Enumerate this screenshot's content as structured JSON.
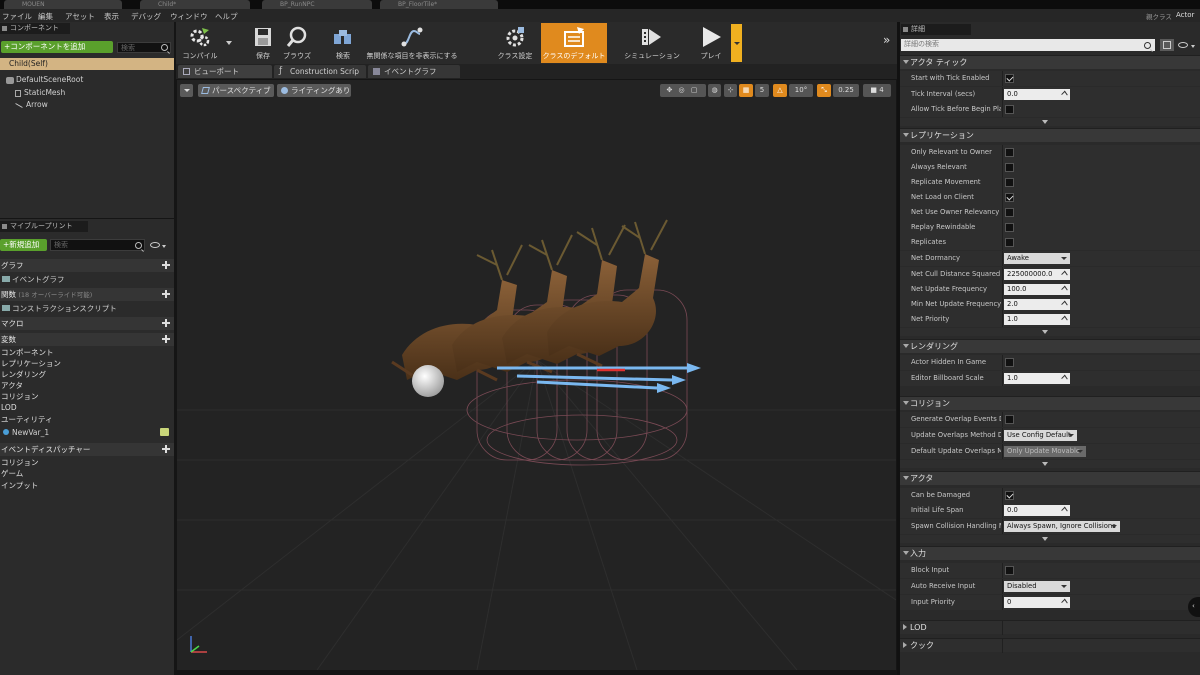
{
  "file_tabs": [
    "MOUEN",
    "Child*",
    "BP_RunNPC",
    "BP_FloorTile*"
  ],
  "menu": {
    "items": [
      "ファイル",
      "編集",
      "アセット",
      "表示",
      "デバッグ",
      "ウィンドウ",
      "ヘルプ"
    ],
    "parent_class": "親クラス",
    "parent_value": "Actor"
  },
  "components": {
    "header": "コンポーネント",
    "add_button": "+コンポーネントを追加",
    "search_placeholder": "検索",
    "self": "Child(Self)",
    "tree": [
      "DefaultSceneRoot",
      "StaticMesh",
      "Arrow"
    ]
  },
  "my_blueprint": {
    "header": "マイブループリント",
    "add_new": "+新規追加",
    "search_placeholder": "検索",
    "graph": "グラフ",
    "event_graph": "イベントグラフ",
    "functions": "関数",
    "functions_note": "(18 オーバーライド可能)",
    "construction_script": "コンストラクションスクリプト",
    "macros": "マクロ",
    "variables": "変数",
    "variable_categories": [
      "コンポーネント",
      "レプリケーション",
      "レンダリング",
      "アクタ",
      "コリジョン",
      "LOD",
      "ユーティリティ"
    ],
    "new_var": "NewVar_1",
    "dispatchers": "イベントディスパッチャー",
    "dispatcher_categories": [
      "コリジョン",
      "ゲーム",
      "インプット"
    ]
  },
  "toolbar": {
    "compile": "コンパイル",
    "save": "保存",
    "browse": "ブラウズ",
    "find": "検索",
    "hide_unrelated": "無関係な項目を非表示にする",
    "class_settings": "クラス設定",
    "class_defaults": "クラスのデフォルト",
    "simulation": "シミュレーション",
    "play": "プレイ"
  },
  "editor_tabs": [
    "ビューポート",
    "Construction Scrip",
    "イベントグラフ"
  ],
  "viewport": {
    "perspective": "パースペクティブ",
    "lighting": "ライティングあり",
    "grid_value": "5",
    "angle_value": "10°",
    "scale_value": "0.25",
    "camera_value": "4"
  },
  "details": {
    "header": "詳細",
    "search_placeholder": "詳細の検索",
    "sections": [
      {
        "title": "アクタ ティック",
        "rows": [
          {
            "label": "Start with Tick Enabled",
            "type": "check",
            "value": true
          },
          {
            "label": "Tick Interval (secs)",
            "type": "num",
            "value": "0.0"
          },
          {
            "label": "Allow Tick Before Begin Play",
            "type": "check",
            "value": false
          }
        ]
      },
      {
        "title": "レプリケーション",
        "rows": [
          {
            "label": "Only Relevant to Owner",
            "type": "check",
            "value": false
          },
          {
            "label": "Always Relevant",
            "type": "check",
            "value": false
          },
          {
            "label": "Replicate Movement",
            "type": "check",
            "value": false
          },
          {
            "label": "Net Load on Client",
            "type": "check",
            "value": true
          },
          {
            "label": "Net Use Owner Relevancy",
            "type": "check",
            "value": false
          },
          {
            "label": "Replay Rewindable",
            "type": "check",
            "value": false
          },
          {
            "label": "Replicates",
            "type": "check",
            "value": false
          },
          {
            "label": "Net Dormancy",
            "type": "dd",
            "value": "Awake"
          },
          {
            "label": "Net Cull Distance Squared",
            "type": "num",
            "value": "225000000.0"
          },
          {
            "label": "Net Update Frequency",
            "type": "num",
            "value": "100.0"
          },
          {
            "label": "Min Net Update Frequency",
            "type": "num",
            "value": "2.0"
          },
          {
            "label": "Net Priority",
            "type": "num",
            "value": "1.0"
          }
        ]
      },
      {
        "title": "レンダリング",
        "rows": [
          {
            "label": "Actor Hidden In Game",
            "type": "check",
            "value": false
          },
          {
            "label": "Editor Billboard Scale",
            "type": "num",
            "value": "1.0"
          }
        ]
      },
      {
        "title": "コリジョン",
        "rows": [
          {
            "label": "Generate Overlap Events Dur",
            "type": "check",
            "value": false
          },
          {
            "label": "Update Overlaps Method Dur",
            "type": "dd",
            "value": "Use Config Default"
          },
          {
            "label": "Default Update Overlaps Met",
            "type": "dd",
            "value": "Only Update Movable",
            "disabled": true
          }
        ]
      },
      {
        "title": "アクタ",
        "rows": [
          {
            "label": "Can be Damaged",
            "type": "check",
            "value": true
          },
          {
            "label": "Initial Life Span",
            "type": "num",
            "value": "0.0"
          },
          {
            "label": "Spawn Collision Handling Me",
            "type": "dd",
            "value": "Always Spawn, Ignore Collisions"
          }
        ]
      },
      {
        "title": "入力",
        "rows": [
          {
            "label": "Block Input",
            "type": "check",
            "value": false
          },
          {
            "label": "Auto Receive Input",
            "type": "dd",
            "value": "Disabled"
          },
          {
            "label": "Input Priority",
            "type": "num",
            "value": "0"
          }
        ]
      }
    ],
    "collapsed": [
      "LOD",
      "クック"
    ]
  }
}
